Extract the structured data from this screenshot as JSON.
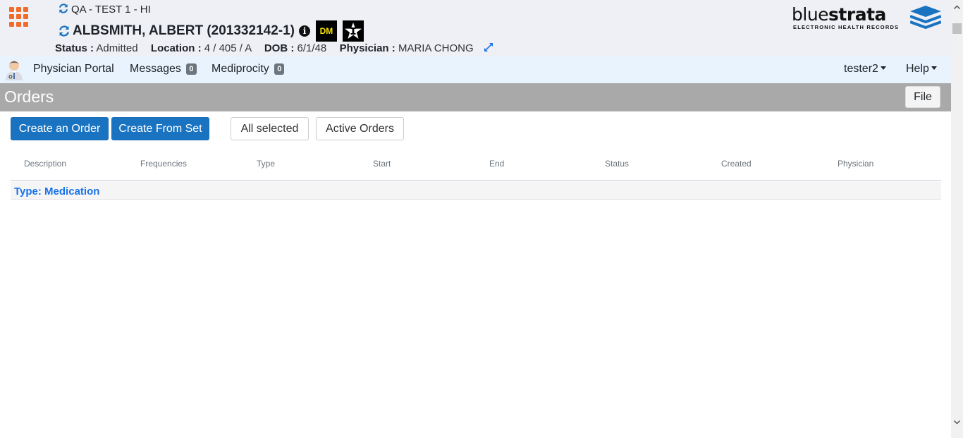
{
  "header": {
    "facility": "QA - TEST 1 - HI",
    "patient_name": "ALBSMITH, ALBERT (201332142-1)",
    "info_glyph": "i",
    "badge_dm": "DM",
    "status_label": "Status :",
    "status_value": "Admitted",
    "location_label": "Location :",
    "location_value": "4 / 405 / A",
    "dob_label": "DOB :",
    "dob_value": "6/1/48",
    "physician_label": "Physician :",
    "physician_value": "MARIA CHONG"
  },
  "logo": {
    "word_light": "blue",
    "word_bold": "strata",
    "subtitle": "ELECTRONIC HEALTH RECORDS"
  },
  "nav": {
    "physician_portal": "Physician Portal",
    "messages": "Messages",
    "messages_count": "0",
    "mediprocity": "Mediprocity",
    "mediprocity_count": "0",
    "user": "tester2",
    "help": "Help"
  },
  "page": {
    "title": "Orders",
    "file_button": "File"
  },
  "toolbar": {
    "create_order": "Create an Order",
    "create_from_set": "Create From Set",
    "all_selected": "All selected",
    "active_orders": "Active Orders"
  },
  "table": {
    "columns": [
      "Description",
      "Frequencies",
      "Type",
      "Start",
      "End",
      "Status",
      "Created",
      "Physician"
    ],
    "group_label": "Type: Medication"
  },
  "colors": {
    "accent": "#1a73c1",
    "grid_icon": "#f26b2a",
    "link": "#1a73e8"
  },
  "icons": [
    "apps-grid-icon",
    "refresh-icon",
    "info-icon",
    "dm-badge-icon",
    "star-badge-icon",
    "expand-icon",
    "avatar-icon",
    "caret-down-icon"
  ]
}
